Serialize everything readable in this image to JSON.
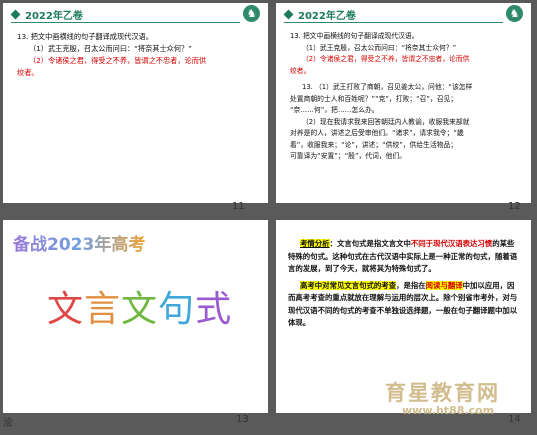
{
  "slides": [
    {
      "number": "11",
      "header": "2022年乙卷",
      "lines": [
        {
          "text": "13. 把文中画横线的句子翻译成现代汉语。",
          "color": "#111111"
        },
        {
          "text": "（1）武王克殷，召太公而问曰：“将奈其士众何？”",
          "color": "#111111"
        },
        {
          "text": "（2）令诸侯之君，得受之不养，皆谓之不忠者，论而供",
          "color": "#d40000"
        },
        {
          "text": "绞者。",
          "color": "#d40000"
        }
      ]
    },
    {
      "number": "12",
      "header": "2022年乙卷",
      "lines": [
        {
          "text": "13. 把文中画横线的句子翻译成现代汉语。",
          "color": "#111111"
        },
        {
          "text": "（1）武王克殷，召太公而问曰：“将奈其士众何？”",
          "color": "#111111"
        },
        {
          "text": "（2）令诸侯之君，得受之不养，皆谓之不忠者，论而供",
          "color": "#d40000"
        },
        {
          "text": "绞者。",
          "color": "#d40000"
        }
      ],
      "answer": [
        "13. （1）武王打败了商朝，召见姜太公，问他：“该怎样",
        "处置商朝的士人和百姓呢？”“克”，打败；“召”，召见；",
        "“奈……何”，把……怎么办。",
        "（2）现在我请求我来回答朝廷内人教谕，收服我来部就",
        "对养是的人，讲述之后受审他们。“诸求”，请求我令；“畿",
        "着”，收服我来；“论”，讲述；“供绞”，供给生活物品；",
        "可靠译为“安置”；“殷”，代词，他们。"
      ]
    },
    {
      "number": "13",
      "top_title": "备战2023年高考",
      "big_title": [
        "文",
        "言",
        "文",
        "句",
        "式"
      ],
      "corner_text": "浍"
    },
    {
      "number": "14",
      "para1": {
        "label": "考情分析",
        "text1": "：文言句式是指文言文中",
        "red1": "不同于现代汉语表达习惯",
        "text2": "的某些特殊的句式。这种句式在古代汉语中实际上是一种正常的句式，随着语言的发展，到了今天，就将其为特殊句式了。"
      },
      "para2": {
        "label": "高考中对常见文言句式的考查",
        "text1": "，是指在",
        "red1": "阅读与翻译",
        "text2": "中加以应用，因而高考考查的重点就放在理解与运用的层次上。除个别省市考外，对与现代汉语不同的句式的考查不单独设选择题，一般在句子翻译题中加以体现。"
      },
      "watermark": "育星教育网",
      "watermark_url": "www.ht88.com"
    }
  ],
  "colors": {
    "accent_green": "#1e7a5f",
    "red": "#d40000",
    "highlight": "#ffff00",
    "background": "#5a5a5a"
  }
}
